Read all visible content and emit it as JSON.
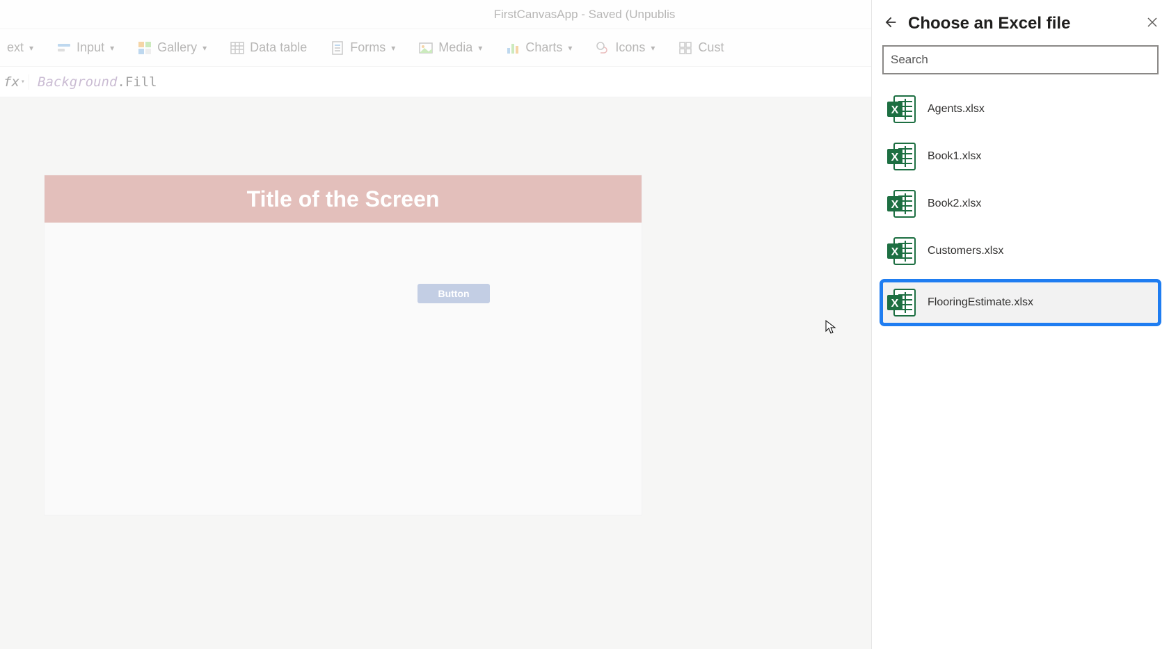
{
  "title_bar": "FirstCanvasApp - Saved (Unpublis",
  "ribbon": {
    "text": "ext",
    "input": "Input",
    "gallery": "Gallery",
    "data_table": "Data table",
    "forms": "Forms",
    "media": "Media",
    "charts": "Charts",
    "icons": "Icons",
    "custom": "Cust"
  },
  "fx_label": "fx",
  "formula": {
    "object": "Background",
    "property": ".Fill"
  },
  "canvas": {
    "title": "Title of the Screen",
    "button": "Button"
  },
  "panel": {
    "title": "Choose an Excel file",
    "search_placeholder": "Search",
    "files": [
      "Agents.xlsx",
      "Book1.xlsx",
      "Book2.xlsx",
      "Customers.xlsx",
      "FlooringEstimate.xlsx"
    ],
    "selected_index": 4
  }
}
